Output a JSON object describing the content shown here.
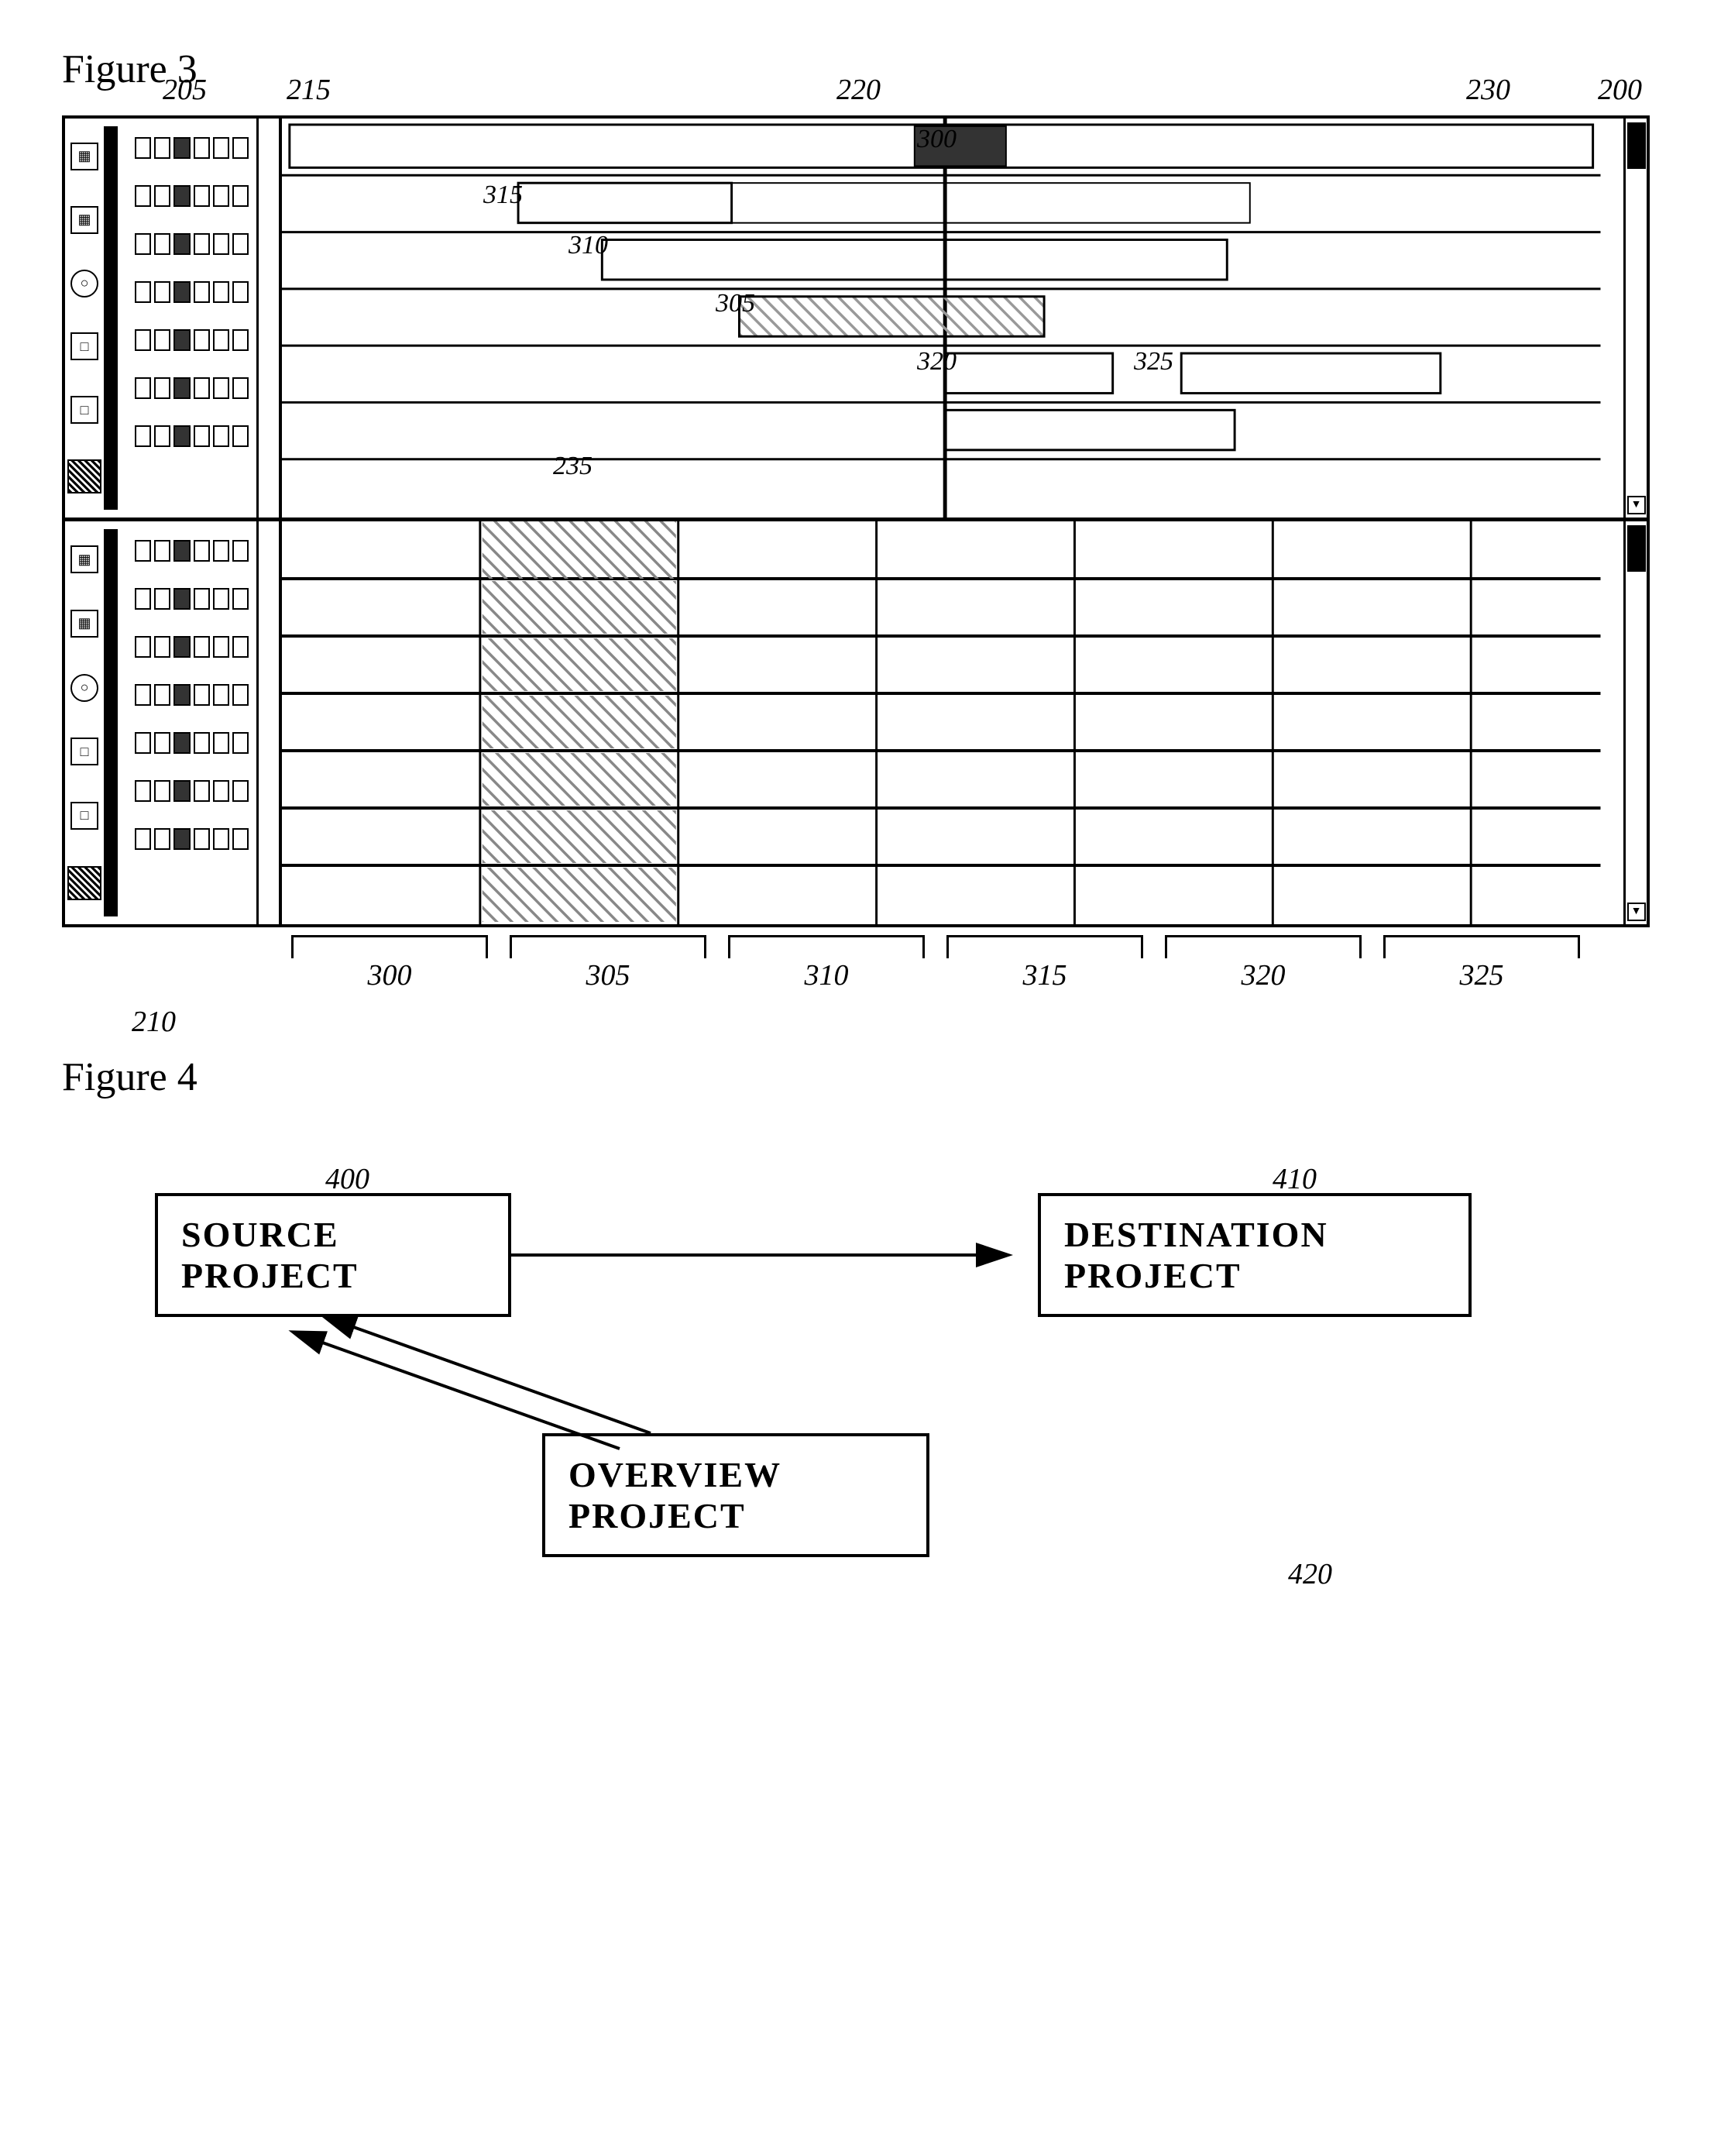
{
  "fig3": {
    "title": "Figure 3",
    "refs": {
      "r200": "200",
      "r205": "205",
      "r210": "210",
      "r215": "215",
      "r220": "220",
      "r230": "230",
      "r235": "235",
      "r300": "300",
      "r305": "305",
      "r310": "310",
      "r315": "315",
      "r320": "320",
      "r325": "325"
    },
    "bottom_labels": {
      "col300": "300",
      "col305": "305",
      "col310": "310",
      "col315": "315",
      "col320": "320",
      "col325": "325"
    }
  },
  "fig4": {
    "title": "Figure 4",
    "refs": {
      "r400": "400",
      "r410": "410",
      "r420": "420"
    },
    "boxes": {
      "source": "SOURCE PROJECT",
      "destination": "DESTINATION PROJECT",
      "overview": "OVERVIEW PROJECT"
    }
  }
}
